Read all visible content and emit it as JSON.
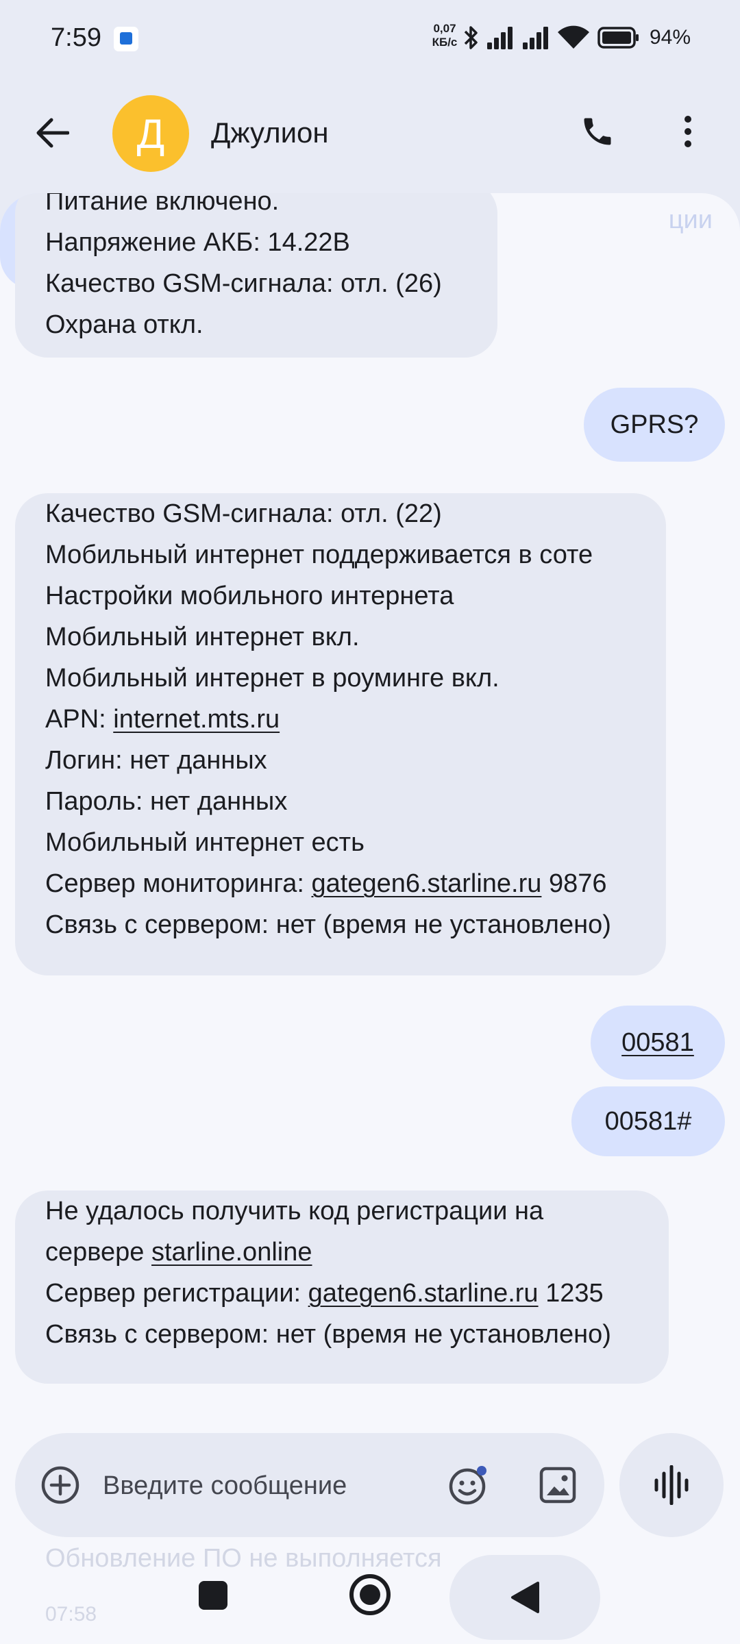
{
  "status_bar": {
    "time": "7:59",
    "net_speed_value": "0,07",
    "net_speed_unit": "КБ/с",
    "battery": "94%"
  },
  "header": {
    "avatar_letter": "Д",
    "contact_name": "Джулион",
    "avatar_color": "#fbc02d"
  },
  "messages": {
    "m1": {
      "lines": [
        "Питание включено.",
        "Напряжение АКБ: 14.22В",
        "Качество GSM-сигнала: отл. (26)",
        "Охрана откл."
      ]
    },
    "m2": {
      "text": "GPRS?"
    },
    "m3": {
      "l1": "Качество GSM-сигнала: отл. (22)",
      "l2": "Мобильный интернет поддерживается в соте",
      "l3": "Настройки мобильного интернета",
      "l4": "Мобильный интернет вкл.",
      "l5": "Мобильный интернет в роуминге вкл.",
      "l6_prefix": "APN: ",
      "l6_link": "internet.mts.ru",
      "l7": "Логин: нет данных",
      "l8": "Пароль: нет данных",
      "l9": "Мобильный интернет есть",
      "l10_prefix": "Сервер мониторинга: ",
      "l10_link": "gategen6.starline.ru",
      "l10_suffix": " 9876",
      "l11": "Связь с сервером: нет (время не установлено)"
    },
    "m4": {
      "text": "00581"
    },
    "m5": {
      "text": "00581#"
    },
    "m6": {
      "l1": "Не удалось получить код регистрации на",
      "l2_prefix": "сервере ",
      "l2_link": "starline.online",
      "l3_prefix": "Сервер регистрации: ",
      "l3_link": "gategen6.starline.ru",
      "l3_suffix": " 1235",
      "l4": "Связь с сервером: нет (время не установлено)"
    },
    "m7_partial": "ции",
    "behind_1": "Обновление ПО не выполняется",
    "behind_2": "07:58"
  },
  "compose": {
    "placeholder": "Введите сообщение"
  },
  "colors": {
    "incoming_bubble": "#e6e9f3",
    "outgoing_bubble": "#d8e2fe",
    "background": "#f6f7fc"
  }
}
